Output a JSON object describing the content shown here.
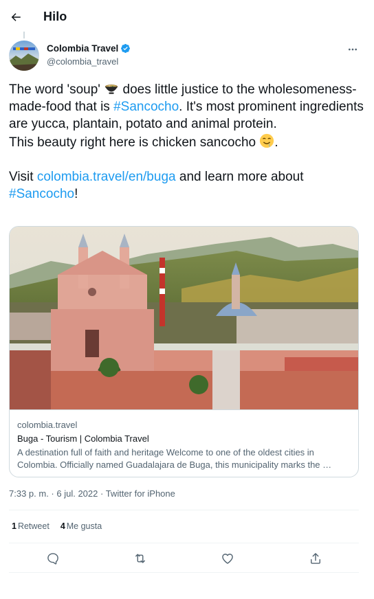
{
  "header": {
    "title": "Hilo",
    "back_icon": "arrow-left-icon"
  },
  "author": {
    "name": "Colombia Travel",
    "handle": "@colombia_travel",
    "verified_icon": "verified-badge-icon",
    "verified_color": "#1d9bf0",
    "more_icon": "more-horizontal-icon"
  },
  "tweet": {
    "p1_a": "The word 'soup' ",
    "p1_emoji1": "bowl-emoji-icon",
    "p1_b": " does little justice to the wholesomeness-made-food that is ",
    "p1_hashtag": "#Sancocho",
    "p1_c": ". It's most prominent ingredients are yucca, plantain, potato and animal protein.",
    "p2_a": "This beauty right here is chicken sancocho ",
    "p2_emoji": "drooling-face-emoji-icon",
    "p2_b": ".",
    "p3_a": "Visit ",
    "p3_link": "colombia.travel/en/buga",
    "p3_b": " and learn more about ",
    "p3_hashtag": "#Sancocho",
    "p3_c": "!"
  },
  "card": {
    "domain": "colombia.travel",
    "title": "Buga - Tourism | Colombia Travel",
    "description": "A destination full of faith and heritage Welcome to one of the oldest cities in Colombia. Officially named Guadalajara de Buga, this municipality marks the …"
  },
  "meta": {
    "time": "7:33 p. m.",
    "date": "6 jul. 2022",
    "source": "Twitter for iPhone",
    "sep": " · "
  },
  "stats": {
    "retweets_count": "1",
    "retweets_label": "Retweet",
    "likes_count": "4",
    "likes_label": "Me gusta"
  },
  "actions": {
    "reply": "reply-icon",
    "retweet": "retweet-icon",
    "like": "heart-icon",
    "share": "share-icon"
  },
  "colors": {
    "link": "#1d9bf0",
    "text": "#0f1419",
    "secondary": "#536471",
    "border": "#cfd9de"
  }
}
